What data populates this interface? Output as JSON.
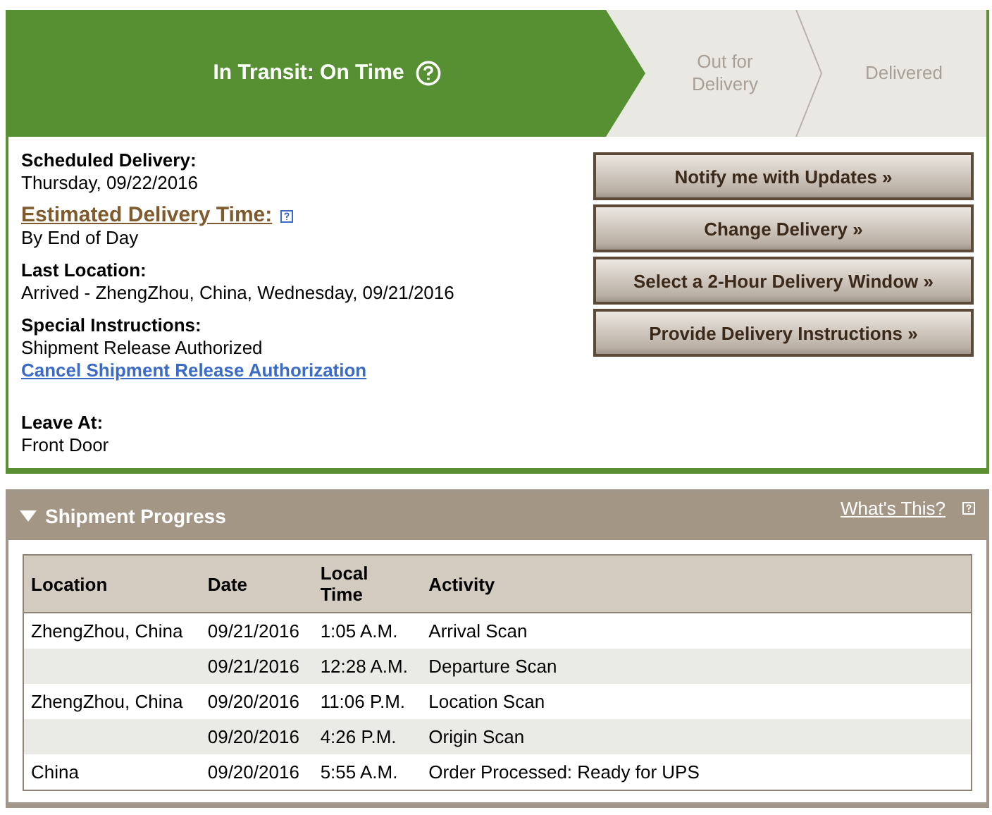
{
  "status_steps": [
    {
      "label": "In Transit: On Time",
      "selected": true,
      "help": true
    },
    {
      "label": "Out for\nDelivery",
      "selected": false,
      "help": false
    },
    {
      "label": "Delivered",
      "selected": false,
      "help": false
    }
  ],
  "details": [
    {
      "kind": "field",
      "label": "Scheduled Delivery:",
      "value": "Thursday, 09/22/2016"
    },
    {
      "kind": "estimate",
      "label": "Estimated Delivery Time:",
      "value": "By End of Day"
    },
    {
      "kind": "field",
      "label": "Last Location:",
      "value": "Arrived - ZhengZhou, China, Wednesday, 09/21/2016"
    },
    {
      "kind": "field",
      "label": "Special Instructions:",
      "value": "Shipment Release Authorized",
      "link": "Cancel Shipment Release Authorization"
    },
    {
      "kind": "field",
      "label": "Leave At:",
      "value": "Front Door"
    }
  ],
  "actions": [
    "Notify me with Updates »",
    "Change Delivery »",
    "Select a 2-Hour Delivery Window »",
    "Provide Delivery Instructions »"
  ],
  "progress": {
    "title": "Shipment Progress",
    "expanded": true,
    "help_link": "What's This?",
    "columns": [
      "Location",
      "Date",
      "Local\nTime",
      "Activity"
    ],
    "rows": [
      [
        "ZhengZhou, China",
        "09/21/2016",
        "1:05 A.M.",
        "Arrival Scan"
      ],
      [
        "",
        "09/21/2016",
        "12:28 A.M.",
        "Departure Scan"
      ],
      [
        "ZhengZhou, China",
        "09/20/2016",
        "11:06 P.M.",
        "Location Scan"
      ],
      [
        "",
        "09/20/2016",
        "4:26 P.M.",
        "Origin Scan"
      ],
      [
        "China",
        "09/20/2016",
        "5:55 A.M.",
        "Order Processed: Ready for UPS"
      ]
    ]
  }
}
